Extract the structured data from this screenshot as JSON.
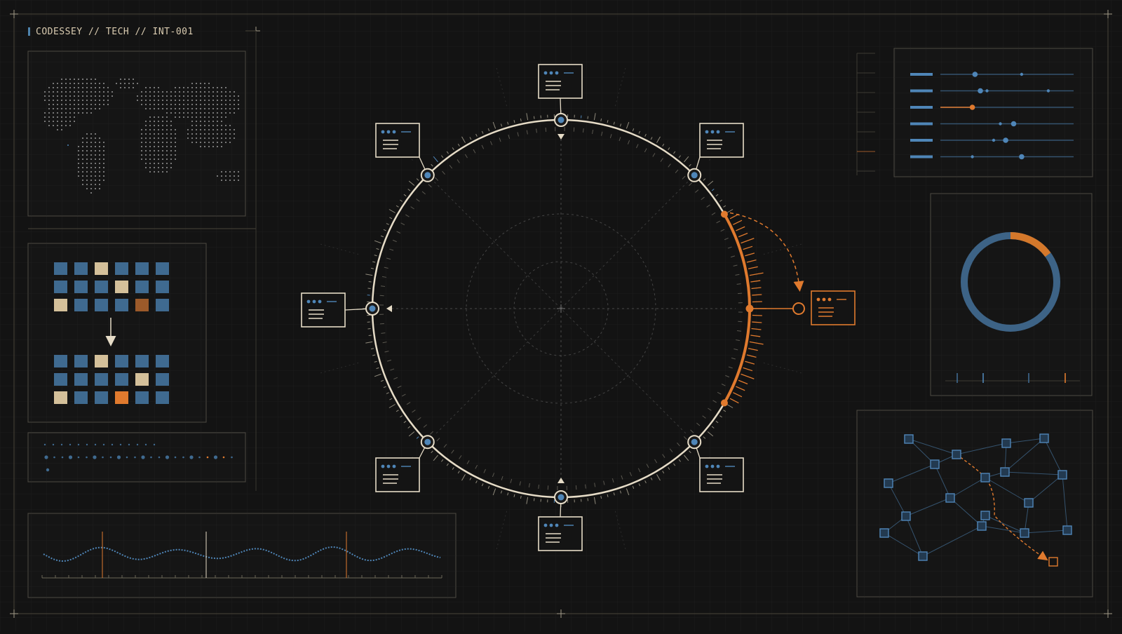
{
  "header": {
    "title": "CODESSEY // TECH // INT-001"
  },
  "colors": {
    "background": "#131313",
    "cream": "#e6dcc7",
    "blue": "#3f6a90",
    "orange": "#e07a2e",
    "grid": "#262626"
  },
  "icons": [
    "crosshair-icon",
    "world-map-icon",
    "window-card-icon",
    "arrow-down-icon",
    "donut-chart-icon",
    "network-graph-icon"
  ],
  "diagram": {
    "ring_nodes": 8,
    "active_node": "east",
    "highlight_arc": "east"
  },
  "pattern_grid": {
    "before": [
      [
        "blue",
        "blue",
        "cream",
        "blue",
        "blue",
        "blue"
      ],
      [
        "blue",
        "blue",
        "blue",
        "cream",
        "blue",
        "blue"
      ],
      [
        "cream",
        "blue",
        "blue",
        "blue",
        "brown",
        "blue"
      ]
    ],
    "after": [
      [
        "blue",
        "blue",
        "cream",
        "blue",
        "blue",
        "blue"
      ],
      [
        "blue",
        "blue",
        "blue",
        "blue",
        "cream",
        "blue"
      ],
      [
        "cream",
        "blue",
        "blue",
        "orange",
        "blue",
        "blue"
      ]
    ]
  },
  "sliders": [
    {
      "level": 0.26,
      "knobs": [
        0.26,
        0.61
      ],
      "active": false
    },
    {
      "level": 0.3,
      "knobs": [
        0.3,
        0.35,
        0.81
      ],
      "active": false
    },
    {
      "level": 0.24,
      "knobs": [
        0.24
      ],
      "active": true
    },
    {
      "level": 0.55,
      "knobs": [
        0.45,
        0.55
      ],
      "active": false
    },
    {
      "level": 0.49,
      "knobs": [
        0.4,
        0.49
      ],
      "active": false
    },
    {
      "level": 0.61,
      "knobs": [
        0.24,
        0.61
      ],
      "active": false
    }
  ],
  "donut": {
    "total_fraction": 1.0,
    "highlight_fraction": 0.15
  }
}
